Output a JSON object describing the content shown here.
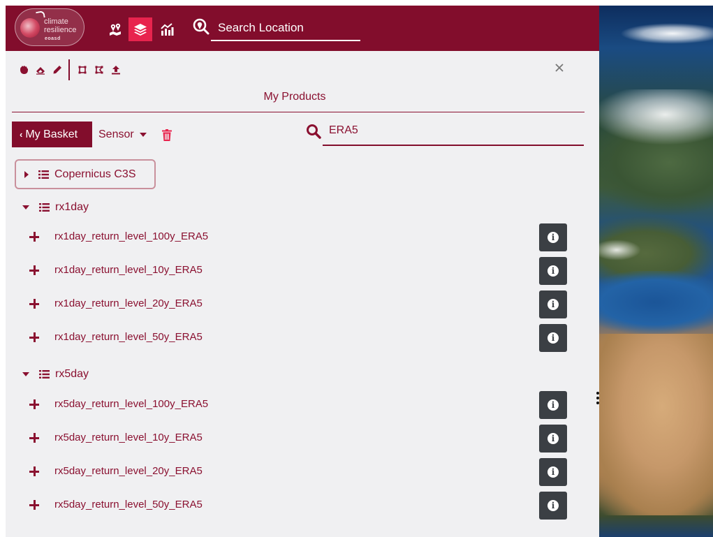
{
  "logo": {
    "line1": "climate",
    "line2": "resilience",
    "line3": "eoasd"
  },
  "header": {
    "search_location": "Search Location"
  },
  "panel": {
    "title": "My Products",
    "basket_label": "My Basket",
    "basket_chevron": "‹",
    "sensor_label": "Sensor",
    "search_value": "ERA5"
  },
  "tree": {
    "collapsed_group": "Copernicus C3S",
    "groups": [
      {
        "label": "rx1day",
        "items": [
          "rx1day_return_level_100y_ERA5",
          "rx1day_return_level_10y_ERA5",
          "rx1day_return_level_20y_ERA5",
          "rx1day_return_level_50y_ERA5"
        ]
      },
      {
        "label": "rx5day",
        "items": [
          "rx5day_return_level_100y_ERA5",
          "rx5day_return_level_10y_ERA5",
          "rx5day_return_level_20y_ERA5",
          "rx5day_return_level_50y_ERA5"
        ]
      }
    ],
    "info_glyph": "i"
  },
  "colors": {
    "brand": "#820d2c",
    "active": "#e8244e",
    "info_button": "#3b3f44",
    "panel_bg": "#f0f0f2"
  },
  "icons": {
    "nav": [
      "map-pins-icon",
      "layers-icon",
      "chart-icon"
    ],
    "toolbar": [
      "hand-icon",
      "eraser-icon",
      "pencil-icon",
      "draw-rectangle-icon",
      "draw-polygon-icon",
      "upload-icon"
    ]
  }
}
